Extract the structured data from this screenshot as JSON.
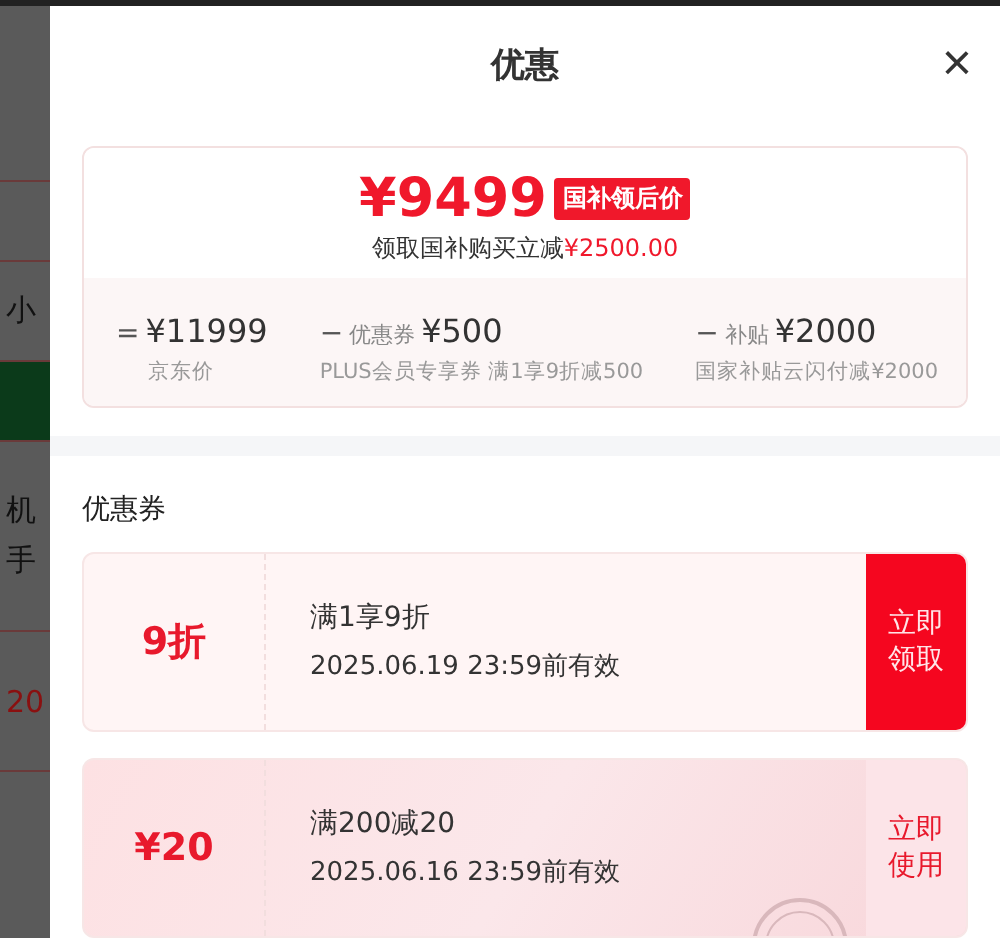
{
  "background_page": {
    "texts": [
      "小",
      "机",
      "手",
      "20"
    ]
  },
  "sheet": {
    "title": "优惠",
    "close": "×"
  },
  "summary": {
    "price": "¥9499",
    "badge": "国补领后价",
    "note_prefix": "领取国补购买立减",
    "note_amount": "¥2500.00",
    "breakdown": [
      {
        "op": "=",
        "amount": "¥11999",
        "caption": "京东价"
      },
      {
        "op": "−",
        "label": "优惠券",
        "amount": "¥500",
        "caption": "PLUS会员专享券 满1享9折减500"
      },
      {
        "op": "−",
        "label": "补贴",
        "amount": "¥2000",
        "caption": "国家补贴云闪付减¥2000"
      }
    ]
  },
  "coupons_section": {
    "title": "优惠券",
    "coupons": [
      {
        "value": "9折",
        "condition": "满1享9折",
        "expiry": "2025.06.19 23:59前有效",
        "action": "立即领取",
        "claimed": false
      },
      {
        "value": "¥20",
        "condition": "满200减20",
        "expiry": "2025.06.16 23:59前有效",
        "action": "立即使用",
        "claimed": true
      }
    ]
  }
}
